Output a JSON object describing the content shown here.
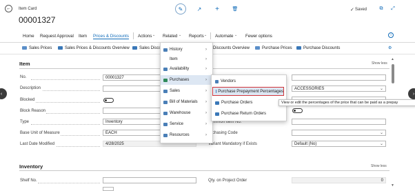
{
  "header": {
    "page_type": "Item Card",
    "record_no": "00001327",
    "saved_label": "Saved",
    "icons": [
      "back-icon",
      "edit-icon",
      "share-icon",
      "add-icon",
      "delete-icon",
      "saved-check-icon",
      "open-new-window-icon",
      "collapse-icon"
    ]
  },
  "actionbar": {
    "items": [
      "Home",
      "Request Approval",
      "Item",
      "Prices & Discounts",
      "Actions",
      "Related",
      "Reports",
      "Automate",
      "Fewer options"
    ],
    "active": "Prices & Discounts"
  },
  "promoted": {
    "items": [
      "Sales Prices",
      "Sales Prices & Discounts Overview",
      "Sales Discou",
      "Discounts Overview",
      "Purchase Prices",
      "Purchase Discounts"
    ]
  },
  "item_section": {
    "title": "Item",
    "show_less": "Show less",
    "fields": [
      {
        "label": "No.",
        "value": "00001327"
      },
      {
        "label": "Description",
        "value": ""
      },
      {
        "label": "Blocked",
        "value": ""
      },
      {
        "label": "Block Reason",
        "value": ""
      },
      {
        "label": "Type",
        "value": "Inventory"
      },
      {
        "label": "Base Unit of Measure",
        "value": "EACH"
      },
      {
        "label": "Last Date Modified",
        "value": "4/28/2025"
      }
    ],
    "right_fields": [
      {
        "label": "",
        "value": ""
      },
      {
        "label": "",
        "value": "ACCESSORIES"
      },
      {
        "label": "",
        "value": ""
      },
      {
        "label": "ommon Item No.",
        "value": ""
      },
      {
        "label": "rchasing Code",
        "value": ""
      },
      {
        "label": "Variant Mandatory if Exists",
        "value": "Default (No)"
      }
    ]
  },
  "inventory_section": {
    "title": "Inventory",
    "show_less": "Show less",
    "shelf_label": "Shelf No.",
    "qty_label": "Qty. on Project Order",
    "qty_value": "0"
  },
  "related_menu": {
    "items": [
      "History",
      "Item",
      "Availability",
      "Purchases",
      "Sales",
      "Bill of Materials",
      "Warehouse",
      "Service",
      "Resources"
    ],
    "highlighted": "Purchases"
  },
  "purchases_menu": {
    "items": [
      "Vendors",
      "Purchase Prepayment Percentages",
      "Purchase Orders",
      "Purchase Return Orders"
    ],
    "highlighted": "Purchase Prepayment Percentages"
  },
  "tooltip": "View or edit the percentages of the price that can be paid as a prepay",
  "colors": {
    "accent": "#0e6ab8",
    "highlight_border": "#d13438",
    "menu_highlight": "#dde7f3"
  }
}
